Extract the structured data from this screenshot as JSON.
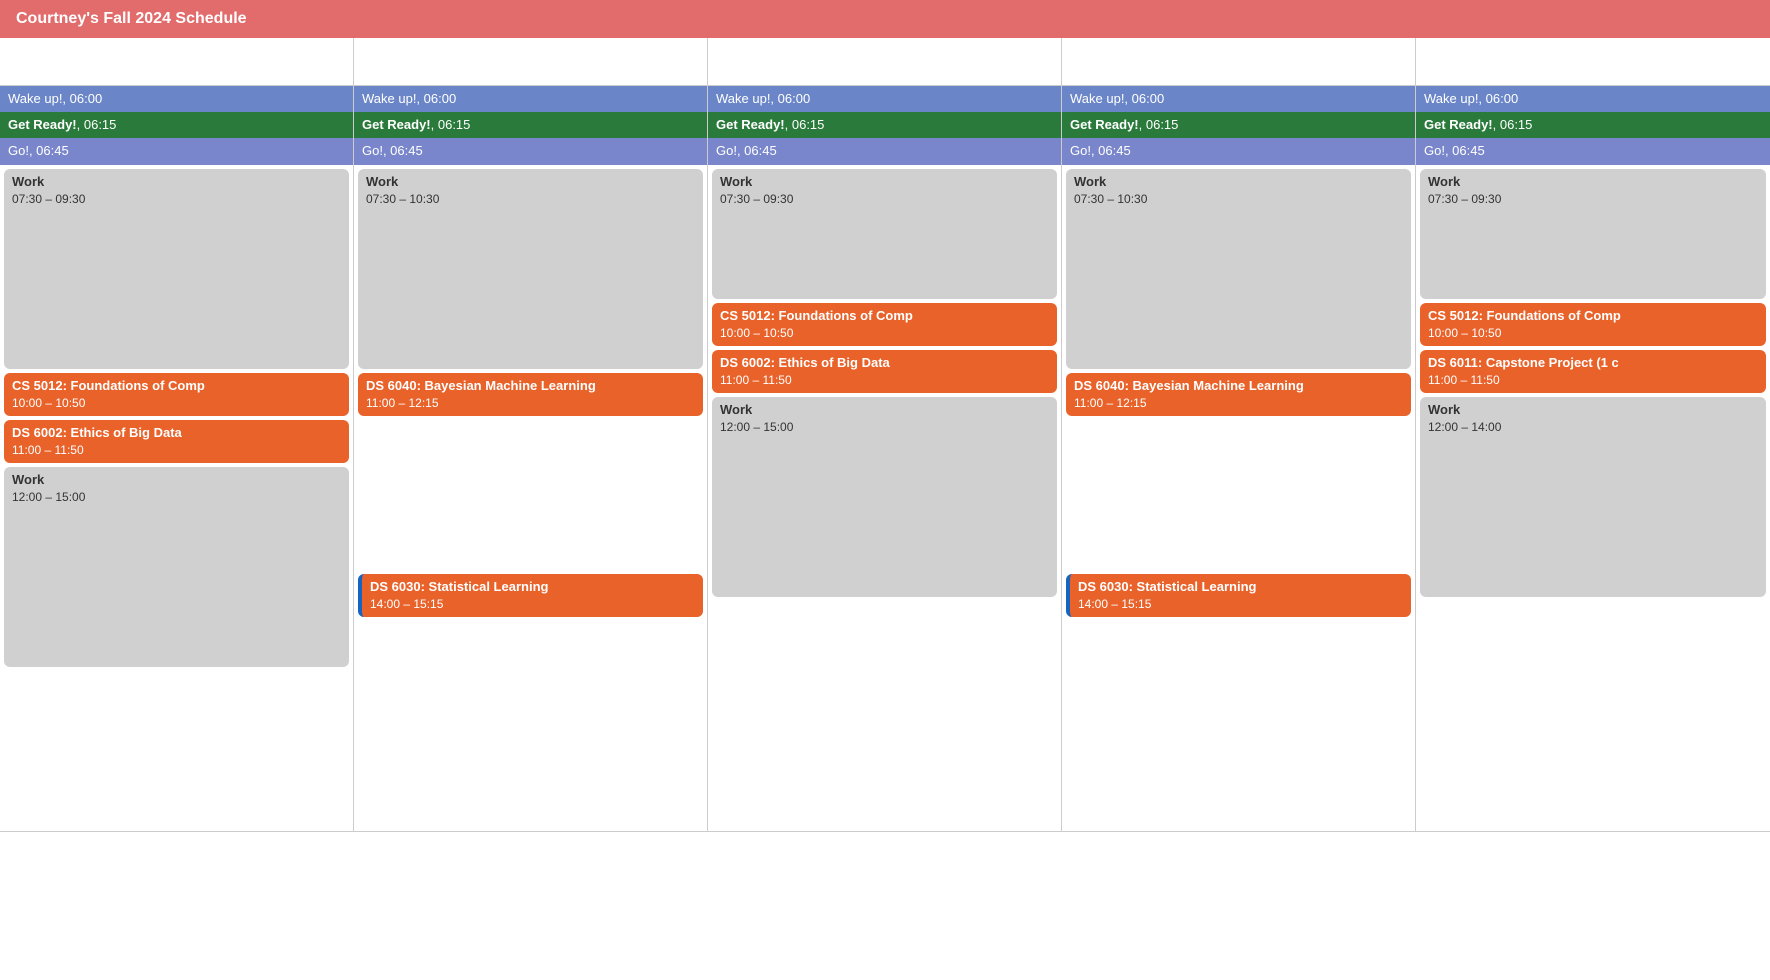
{
  "header": {
    "title": "Courtney's Fall 2024 Schedule"
  },
  "days": [
    {
      "id": "col1",
      "events": [
        {
          "type": "wake",
          "label": "Wake up!, 06:00"
        },
        {
          "type": "ready",
          "label": "Get Ready!, 06:15"
        },
        {
          "type": "go",
          "label": "Go!, 06:45"
        },
        {
          "type": "work",
          "title": "Work",
          "time": "07:30 – 09:30",
          "tall": true
        },
        {
          "type": "class",
          "title": "CS 5012: Foundations of Comp",
          "time": "10:00 – 10:50"
        },
        {
          "type": "class",
          "title": "DS 6002: Ethics of Big Data",
          "time": "11:00 – 11:50"
        },
        {
          "type": "work",
          "title": "Work",
          "time": "12:00 – 15:00",
          "tall": true
        }
      ]
    },
    {
      "id": "col2",
      "events": [
        {
          "type": "wake",
          "label": "Wake up!, 06:00"
        },
        {
          "type": "ready",
          "label": "Get Ready!, 06:15"
        },
        {
          "type": "go",
          "label": "Go!, 06:45"
        },
        {
          "type": "work",
          "title": "Work",
          "time": "07:30 – 10:30",
          "tall": true
        },
        {
          "type": "class",
          "title": "DS 6040: Bayesian Machine Learning",
          "time": "11:00 – 12:15"
        },
        {
          "type": "class-blue",
          "title": "DS 6030: Statistical Learning",
          "time": "14:00 – 15:15"
        }
      ]
    },
    {
      "id": "col3",
      "events": [
        {
          "type": "wake",
          "label": "Wake up!, 06:00"
        },
        {
          "type": "ready",
          "label": "Get Ready!, 06:15"
        },
        {
          "type": "go",
          "label": "Go!, 06:45"
        },
        {
          "type": "work",
          "title": "Work",
          "time": "07:30 – 09:30",
          "tall": false
        },
        {
          "type": "class",
          "title": "CS 5012: Foundations of Comp",
          "time": "10:00 – 10:50"
        },
        {
          "type": "class",
          "title": "DS 6002: Ethics of Big Data",
          "time": "11:00 – 11:50"
        },
        {
          "type": "work",
          "title": "Work",
          "time": "12:00 – 15:00",
          "tall": true
        }
      ]
    },
    {
      "id": "col4",
      "events": [
        {
          "type": "wake",
          "label": "Wake up!, 06:00"
        },
        {
          "type": "ready",
          "label": "Get Ready!, 06:15"
        },
        {
          "type": "go",
          "label": "Go!, 06:45"
        },
        {
          "type": "work",
          "title": "Work",
          "time": "07:30 – 10:30",
          "tall": true
        },
        {
          "type": "class",
          "title": "DS 6040: Bayesian Machine Learning",
          "time": "11:00 – 12:15"
        },
        {
          "type": "class-blue",
          "title": "DS 6030: Statistical Learning",
          "time": "14:00 – 15:15"
        }
      ]
    },
    {
      "id": "col5",
      "events": [
        {
          "type": "wake",
          "label": "Wake up!, 06:00"
        },
        {
          "type": "ready",
          "label": "Get Ready!, 06:15"
        },
        {
          "type": "go",
          "label": "Go!, 06:45"
        },
        {
          "type": "work",
          "title": "Work",
          "time": "07:30 – 09:30",
          "tall": false
        },
        {
          "type": "class",
          "title": "CS 5012: Foundations of Comp",
          "time": "10:00 – 10:50"
        },
        {
          "type": "class",
          "title": "DS 6011: Capstone Project (1 c",
          "time": "11:00 – 11:50"
        },
        {
          "type": "work",
          "title": "Work",
          "time": "12:00 – 14:00",
          "tall": true
        }
      ]
    }
  ]
}
